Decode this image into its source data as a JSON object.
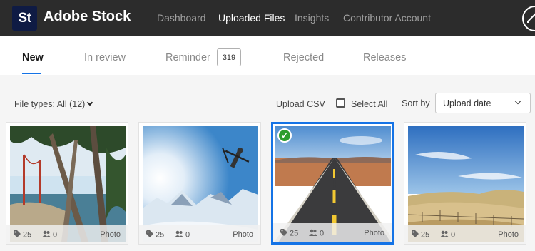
{
  "app": {
    "logo_text": "St",
    "brand": "Adobe Stock",
    "nav": [
      "Dashboard",
      "Uploaded Files",
      "Insights",
      "Contributor Account"
    ],
    "active_nav": "Uploaded Files"
  },
  "tabs": {
    "items": [
      "New",
      "In review",
      "Reminder",
      "Rejected",
      "Releases"
    ],
    "active": "New",
    "reminder_count": "319"
  },
  "toolbar": {
    "file_types": "File types: All (12)",
    "upload_csv": "Upload CSV",
    "select_all": "Select All",
    "sort_label": "Sort by",
    "sort_value": "Upload date"
  },
  "cards": [
    {
      "tags": "25",
      "people": "0",
      "type": "Photo",
      "scene": "trees-bridge",
      "selected": false
    },
    {
      "tags": "25",
      "people": "0",
      "type": "Photo",
      "scene": "ski-jump",
      "selected": false
    },
    {
      "tags": "25",
      "people": "0",
      "type": "Photo",
      "scene": "desert-road",
      "selected": true
    },
    {
      "tags": "25",
      "people": "0",
      "type": "Photo",
      "scene": "fields",
      "selected": false
    }
  ],
  "colors": {
    "topbar": "#2c2c2c",
    "accent": "#1473e6",
    "check": "#2d9d2d"
  }
}
